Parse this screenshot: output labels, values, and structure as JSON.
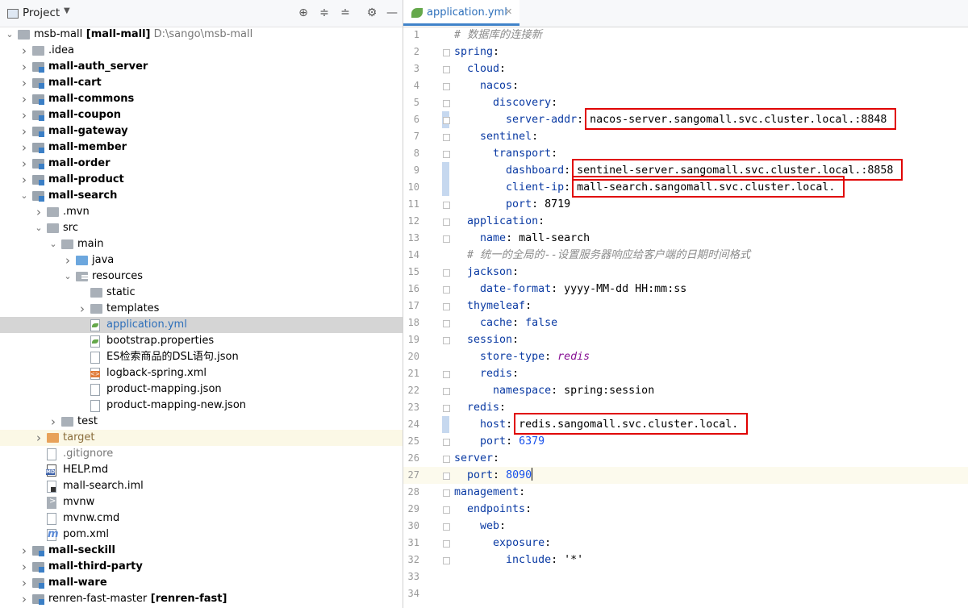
{
  "project_panel": {
    "title": "Project",
    "tree": [
      {
        "text": "msb-mall",
        "suffix": " [mall-mall]",
        "path": "  D:\\sango\\msb-mall",
        "arrow": "down",
        "icon": "folder",
        "depth": 0
      },
      {
        "text": ".idea",
        "arrow": "right",
        "icon": "folder",
        "depth": 1
      },
      {
        "text": "mall-auth_server",
        "arrow": "right",
        "icon": "module",
        "depth": 1,
        "bold": true
      },
      {
        "text": "mall-cart",
        "arrow": "right",
        "icon": "module",
        "depth": 1,
        "bold": true
      },
      {
        "text": "mall-commons",
        "arrow": "right",
        "icon": "module",
        "depth": 1,
        "bold": true
      },
      {
        "text": "mall-coupon",
        "arrow": "right",
        "icon": "module",
        "depth": 1,
        "bold": true
      },
      {
        "text": "mall-gateway",
        "arrow": "right",
        "icon": "module",
        "depth": 1,
        "bold": true
      },
      {
        "text": "mall-member",
        "arrow": "right",
        "icon": "module",
        "depth": 1,
        "bold": true
      },
      {
        "text": "mall-order",
        "arrow": "right",
        "icon": "module",
        "depth": 1,
        "bold": true
      },
      {
        "text": "mall-product",
        "arrow": "right",
        "icon": "module",
        "depth": 1,
        "bold": true
      },
      {
        "text": "mall-search",
        "arrow": "down",
        "icon": "module",
        "depth": 1,
        "bold": true
      },
      {
        "text": ".mvn",
        "arrow": "right",
        "icon": "folder",
        "depth": 2
      },
      {
        "text": "src",
        "arrow": "down",
        "icon": "folder",
        "depth": 2
      },
      {
        "text": "main",
        "arrow": "down",
        "icon": "folder",
        "depth": 3
      },
      {
        "text": "java",
        "arrow": "right",
        "icon": "blue",
        "depth": 4
      },
      {
        "text": "resources",
        "arrow": "down",
        "icon": "res",
        "depth": 4
      },
      {
        "text": "static",
        "arrow": "",
        "icon": "folder",
        "depth": 5
      },
      {
        "text": "templates",
        "arrow": "right",
        "icon": "folder",
        "depth": 5
      },
      {
        "text": "application.yml",
        "arrow": "",
        "icon": "leaf",
        "depth": 5,
        "selected": true,
        "color": "#2d6fba"
      },
      {
        "text": "bootstrap.properties",
        "arrow": "",
        "icon": "leaf",
        "depth": 5
      },
      {
        "text": "ES检索商品的DSL语句.json",
        "arrow": "",
        "icon": "file",
        "depth": 5
      },
      {
        "text": "logback-spring.xml",
        "arrow": "",
        "icon": "xml",
        "depth": 5
      },
      {
        "text": "product-mapping.json",
        "arrow": "",
        "icon": "file",
        "depth": 5
      },
      {
        "text": "product-mapping-new.json",
        "arrow": "",
        "icon": "file",
        "depth": 5
      },
      {
        "text": "test",
        "arrow": "right",
        "icon": "folder",
        "depth": 3
      },
      {
        "text": "target",
        "arrow": "right",
        "icon": "orange",
        "depth": 2,
        "excluded": true,
        "color": "#8a6d3b"
      },
      {
        "text": ".gitignore",
        "arrow": "",
        "icon": "file",
        "depth": 2,
        "color": "#777"
      },
      {
        "text": "HELP.md",
        "arrow": "",
        "icon": "md",
        "depth": 2
      },
      {
        "text": "mall-search.iml",
        "arrow": "",
        "icon": "iml",
        "depth": 2
      },
      {
        "text": "mvnw",
        "arrow": "",
        "icon": "term",
        "depth": 2
      },
      {
        "text": "mvnw.cmd",
        "arrow": "",
        "icon": "file",
        "depth": 2
      },
      {
        "text": "pom.xml",
        "arrow": "",
        "icon": "m",
        "depth": 2
      },
      {
        "text": "mall-seckill",
        "arrow": "right",
        "icon": "module",
        "depth": 1,
        "bold": true
      },
      {
        "text": "mall-third-party",
        "arrow": "right",
        "icon": "module",
        "depth": 1,
        "bold": true
      },
      {
        "text": "mall-ware",
        "arrow": "right",
        "icon": "module",
        "depth": 1,
        "bold": true
      },
      {
        "text": "renren-fast-master",
        "suffix": " [renren-fast]",
        "arrow": "right",
        "icon": "module",
        "depth": 1
      }
    ]
  },
  "editor": {
    "tab_label": "application.yml",
    "lines": [
      {
        "n": "1",
        "indent": 0,
        "parts": [
          [
            "cm",
            "# 数据库的连接新"
          ]
        ]
      },
      {
        "n": "2",
        "indent": 0,
        "parts": [
          [
            "k",
            "spring"
          ],
          [
            "v",
            ":"
          ]
        ],
        "fold": true
      },
      {
        "n": "3",
        "indent": 1,
        "parts": [
          [
            "k",
            "cloud"
          ],
          [
            "v",
            ":"
          ]
        ],
        "fold": true
      },
      {
        "n": "4",
        "indent": 2,
        "parts": [
          [
            "k",
            "nacos"
          ],
          [
            "v",
            ":"
          ]
        ],
        "fold": true
      },
      {
        "n": "5",
        "indent": 3,
        "parts": [
          [
            "k",
            "discovery"
          ],
          [
            "v",
            ":"
          ]
        ],
        "fold": true
      },
      {
        "n": "6",
        "indent": 4,
        "parts": [
          [
            "k",
            "server-addr"
          ],
          [
            "v",
            ": nacos-server.sangomall.svc.cluster.local.:8848"
          ]
        ],
        "fold": true,
        "changed": true
      },
      {
        "n": "7",
        "indent": 2,
        "parts": [
          [
            "k",
            "sentinel"
          ],
          [
            "v",
            ":"
          ]
        ],
        "fold": true
      },
      {
        "n": "8",
        "indent": 3,
        "parts": [
          [
            "k",
            "transport"
          ],
          [
            "v",
            ":"
          ]
        ],
        "fold": true
      },
      {
        "n": "9",
        "indent": 4,
        "parts": [
          [
            "k",
            "dashboard"
          ],
          [
            "v",
            ": sentinel-server.sangomall.svc.cluster.local.:8858"
          ]
        ],
        "changed": true
      },
      {
        "n": "10",
        "indent": 4,
        "parts": [
          [
            "k",
            "client-ip"
          ],
          [
            "v",
            ": mall-search.sangomall.svc.cluster.local."
          ]
        ],
        "changed": true
      },
      {
        "n": "11",
        "indent": 4,
        "parts": [
          [
            "k",
            "port"
          ],
          [
            "v",
            ": 8719"
          ]
        ],
        "fold": true
      },
      {
        "n": "12",
        "indent": 1,
        "parts": [
          [
            "k",
            "application"
          ],
          [
            "v",
            ":"
          ]
        ],
        "fold": true
      },
      {
        "n": "13",
        "indent": 2,
        "parts": [
          [
            "k",
            "name"
          ],
          [
            "v",
            ": mall-search"
          ]
        ],
        "fold": true
      },
      {
        "n": "14",
        "indent": 1,
        "parts": [
          [
            "cm",
            "# 统一的全局的--设置服务器响应给客户端的日期时间格式"
          ]
        ]
      },
      {
        "n": "15",
        "indent": 1,
        "parts": [
          [
            "k",
            "jackson"
          ],
          [
            "v",
            ":"
          ]
        ],
        "fold": true
      },
      {
        "n": "16",
        "indent": 2,
        "parts": [
          [
            "k",
            "date-format"
          ],
          [
            "v",
            ": yyyy-MM-dd HH:mm:ss"
          ]
        ],
        "fold": true
      },
      {
        "n": "17",
        "indent": 1,
        "parts": [
          [
            "k",
            "thymeleaf"
          ],
          [
            "v",
            ":"
          ]
        ],
        "fold": true
      },
      {
        "n": "18",
        "indent": 2,
        "parts": [
          [
            "k",
            "cache"
          ],
          [
            "v",
            ": "
          ],
          [
            "kw",
            "false"
          ]
        ],
        "fold": true
      },
      {
        "n": "19",
        "indent": 1,
        "parts": [
          [
            "k",
            "session"
          ],
          [
            "v",
            ":"
          ]
        ],
        "fold": true
      },
      {
        "n": "20",
        "indent": 2,
        "parts": [
          [
            "k",
            "store-type"
          ],
          [
            "v",
            ": "
          ],
          [
            "it",
            "redis"
          ]
        ]
      },
      {
        "n": "21",
        "indent": 2,
        "parts": [
          [
            "k",
            "redis"
          ],
          [
            "v",
            ":"
          ]
        ],
        "fold": true
      },
      {
        "n": "22",
        "indent": 3,
        "parts": [
          [
            "k",
            "namespace"
          ],
          [
            "v",
            ": spring:session"
          ]
        ],
        "fold": true
      },
      {
        "n": "23",
        "indent": 1,
        "parts": [
          [
            "k",
            "redis"
          ],
          [
            "v",
            ":"
          ]
        ],
        "fold": true
      },
      {
        "n": "24",
        "indent": 2,
        "parts": [
          [
            "k",
            "host"
          ],
          [
            "v",
            ": redis.sangomall.svc.cluster.local."
          ]
        ],
        "changed": true
      },
      {
        "n": "25",
        "indent": 2,
        "parts": [
          [
            "k",
            "port"
          ],
          [
            "v",
            ": "
          ],
          [
            "n",
            "6379"
          ]
        ],
        "fold": true
      },
      {
        "n": "26",
        "indent": 0,
        "parts": [
          [
            "k",
            "server"
          ],
          [
            "v",
            ":"
          ]
        ],
        "fold": true
      },
      {
        "n": "27",
        "indent": 1,
        "parts": [
          [
            "k",
            "port"
          ],
          [
            "v",
            ": "
          ],
          [
            "n",
            "8090"
          ]
        ],
        "fold": true,
        "current": true,
        "cursor": true
      },
      {
        "n": "28",
        "indent": 0,
        "parts": [
          [
            "k",
            "management"
          ],
          [
            "v",
            ":"
          ]
        ],
        "fold": true
      },
      {
        "n": "29",
        "indent": 1,
        "parts": [
          [
            "k",
            "endpoints"
          ],
          [
            "v",
            ":"
          ]
        ],
        "fold": true
      },
      {
        "n": "30",
        "indent": 2,
        "parts": [
          [
            "k",
            "web"
          ],
          [
            "v",
            ":"
          ]
        ],
        "fold": true
      },
      {
        "n": "31",
        "indent": 3,
        "parts": [
          [
            "k",
            "exposure"
          ],
          [
            "v",
            ":"
          ]
        ],
        "fold": true
      },
      {
        "n": "32",
        "indent": 4,
        "parts": [
          [
            "k",
            "include"
          ],
          [
            "v",
            ": "
          ],
          [
            "v",
            "'*'"
          ]
        ],
        "fold": true
      },
      {
        "n": "33",
        "indent": 0,
        "parts": []
      },
      {
        "n": "34",
        "indent": 0,
        "parts": []
      }
    ],
    "highlight_lines": [
      "6",
      "9",
      "10",
      "24"
    ]
  }
}
